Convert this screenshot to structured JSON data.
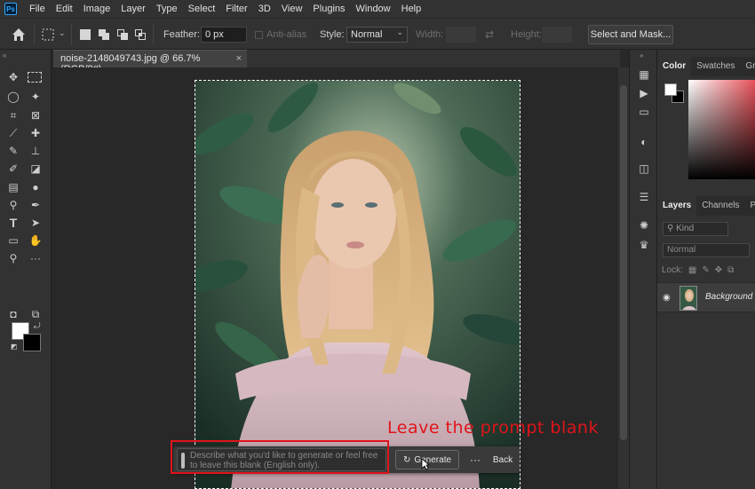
{
  "menubar": {
    "logo": "Ps",
    "items": [
      "File",
      "Edit",
      "Image",
      "Layer",
      "Type",
      "Select",
      "Filter",
      "3D",
      "View",
      "Plugins",
      "Window",
      "Help"
    ]
  },
  "options": {
    "feather_label": "Feather:",
    "feather_value": "0 px",
    "antialias_label": "Anti-alias",
    "style_label": "Style:",
    "style_value": "Normal",
    "width_label": "Width:",
    "height_label": "Height:",
    "select_mask_label": "Select and Mask..."
  },
  "document": {
    "tab_title": "noise-2148049743.jpg @ 66.7% (RGB/8#)",
    "close_glyph": "×"
  },
  "taskbar": {
    "prompt_placeholder": "Describe what you'd like to generate or feel free to leave this blank (English only).",
    "generate_label": "Generate",
    "more_glyph": "···",
    "back_label": "Back"
  },
  "annotation": {
    "text": "Leave the prompt blank",
    "color": "#e0141a"
  },
  "panels": {
    "color_tabs": [
      "Color",
      "Swatches",
      "Gr"
    ],
    "layers_tabs": [
      "Layers",
      "Channels",
      "P"
    ],
    "kind_label": "Kind",
    "blend_mode": "Normal",
    "lock_label": "Lock:",
    "layer_name": "Background"
  },
  "colors": {
    "accent": "#31a8ff",
    "highlight_box": "#e0141a"
  }
}
